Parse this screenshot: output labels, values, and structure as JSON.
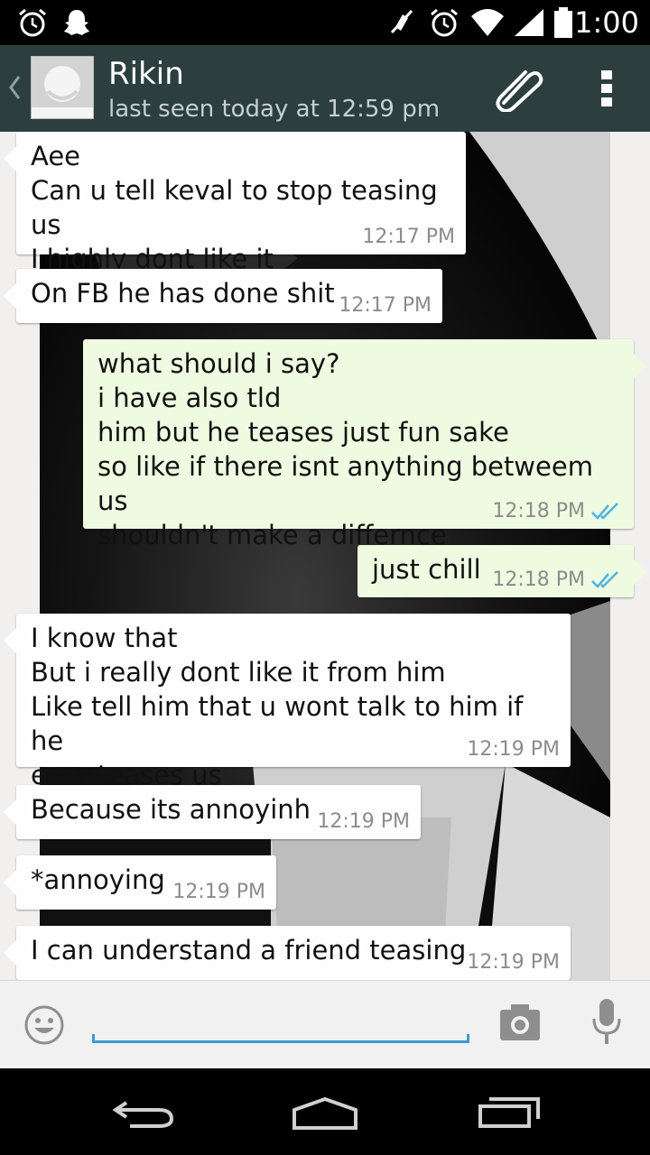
{
  "status_bar": {
    "time": "1:00",
    "icons": [
      "alarm-icon",
      "snapchat-icon",
      "mute-icon",
      "alarm-icon",
      "wifi-icon",
      "signal-icon",
      "battery-icon"
    ]
  },
  "header": {
    "contact_name": "Rikin",
    "last_seen": "last seen today at 12:59 pm",
    "icons": [
      "back-icon",
      "avatar-placeholder",
      "attach-icon",
      "overflow-menu-icon"
    ]
  },
  "messages": [
    {
      "direction": "in",
      "text": "Aee\nCan u tell keval to stop teasing us\nI highly dont like it",
      "time": "12:17 PM"
    },
    {
      "direction": "in",
      "text": "On FB he has done shit",
      "time": "12:17 PM"
    },
    {
      "direction": "out",
      "text": "what should i say?\ni have also tld\nhim but he teases just fun sake\nso like if there isnt anything betweem us\nshouldn't make a differnce",
      "time": "12:18 PM",
      "status": "read"
    },
    {
      "direction": "out",
      "text": "just chill",
      "time": "12:18 PM",
      "status": "read"
    },
    {
      "direction": "in",
      "text": "I know that\nBut i really dont like it from him\nLike tell him that u wont talk to him if he\never teases us",
      "time": "12:19 PM"
    },
    {
      "direction": "in",
      "text": "Because its annoyinh",
      "time": "12:19 PM"
    },
    {
      "direction": "in",
      "text": "*annoying",
      "time": "12:19 PM"
    },
    {
      "direction": "in",
      "text": "I can understand a friend teasing",
      "time": "12:19 PM"
    }
  ],
  "input_bar": {
    "placeholder": "",
    "value": "",
    "icons": [
      "emoji-icon",
      "camera-icon",
      "mic-icon"
    ]
  },
  "nav_bar": {
    "icons": [
      "nav-back-icon",
      "nav-home-icon",
      "nav-recents-icon"
    ]
  },
  "colors": {
    "action_bar": "#2d3e3f",
    "incoming_bubble": "#fefefe",
    "outgoing_bubble": "#eefbe0",
    "read_ticks": "#4fb3e6",
    "input_accent": "#3a9bd1"
  }
}
